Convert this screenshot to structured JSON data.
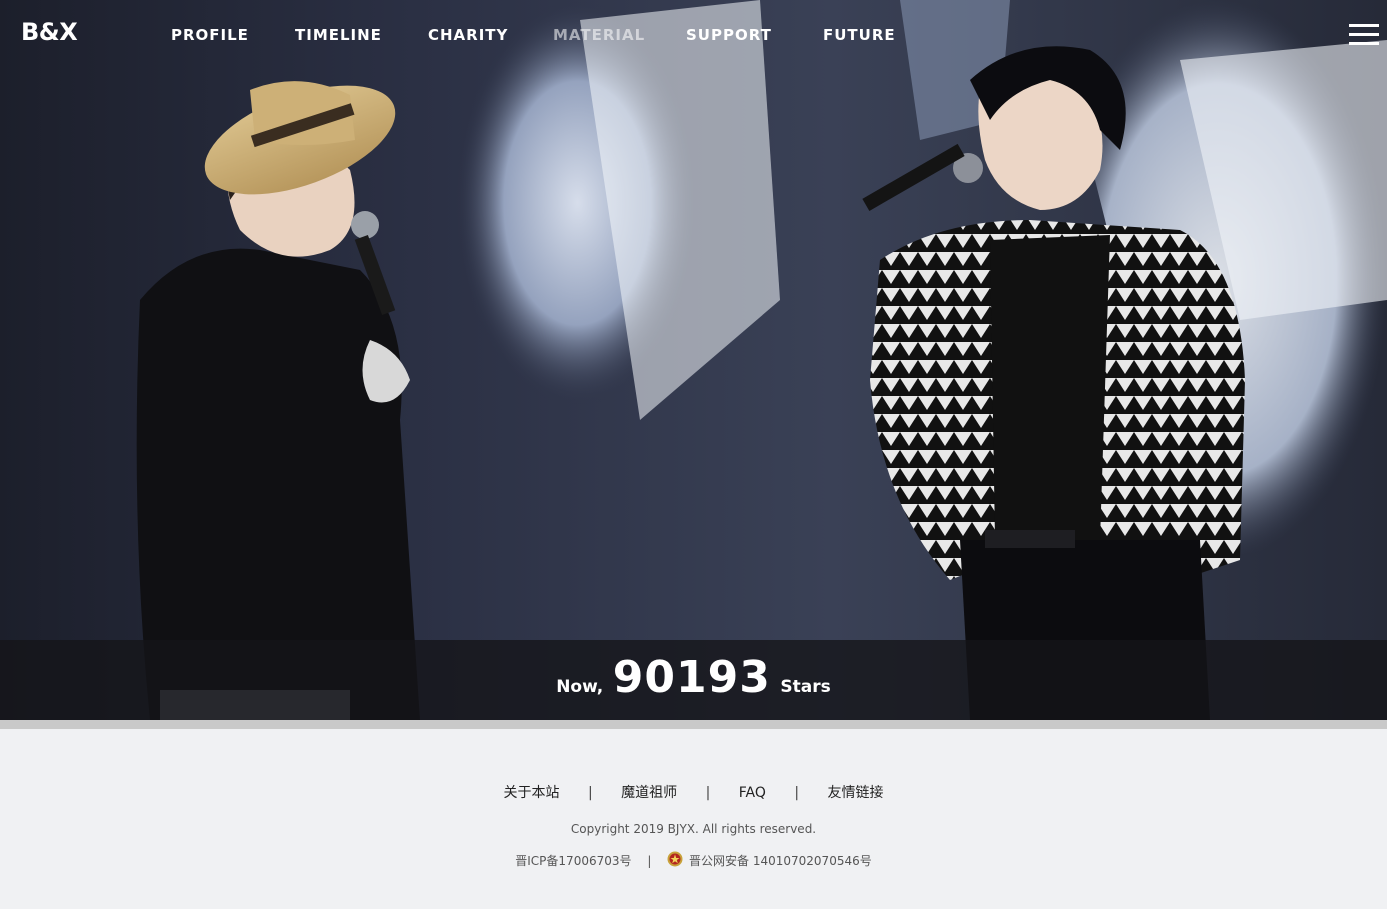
{
  "header": {
    "brand": "B&X",
    "nav": [
      {
        "label": "PROFILE"
      },
      {
        "label": "TIMELINE"
      },
      {
        "label": "CHARITY"
      },
      {
        "label": "MATERIAL"
      },
      {
        "label": "SUPPORT"
      },
      {
        "label": "FUTURE"
      }
    ],
    "menu_icon": "hamburger-menu-icon"
  },
  "hero": {
    "image_description_icon": "concert-photo",
    "counter": {
      "prefix": "Now,",
      "value": "90193",
      "suffix": "Stars"
    }
  },
  "footer": {
    "links": [
      {
        "label": "关于本站"
      },
      {
        "label": "魔道祖师"
      },
      {
        "label": "FAQ"
      },
      {
        "label": "友情链接"
      }
    ],
    "separator": "|",
    "copyright": "Copyright 2019 BJYX. All rights reserved.",
    "icp": "晋ICP备17006703号",
    "police_icon": "police-badge-icon",
    "police": "晋公网安备 14010702070546号"
  },
  "colors": {
    "hero_bg": "#1b1c22",
    "footer_bg": "#f0f1f3",
    "nav_text": "#ffffff"
  }
}
